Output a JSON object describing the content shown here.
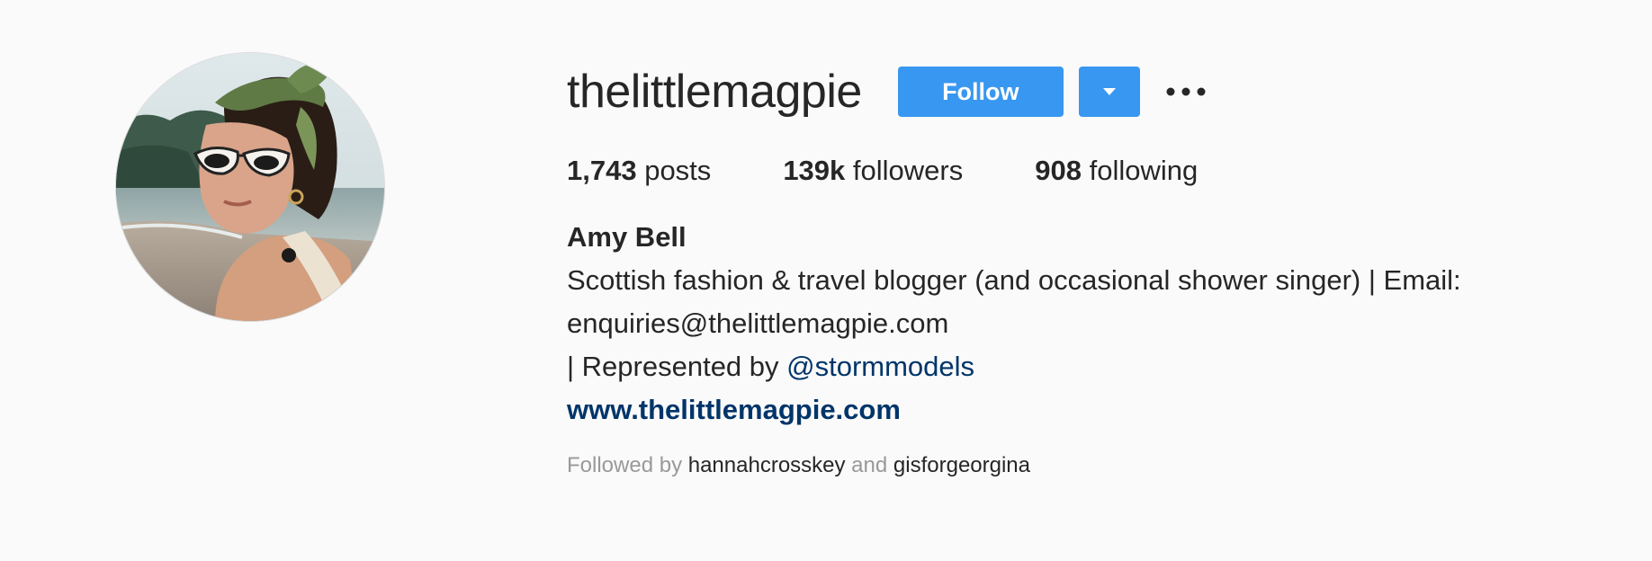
{
  "profile": {
    "username": "thelittlemagpie",
    "avatar_alt": "profile-photo"
  },
  "actions": {
    "follow_label": "Follow",
    "dropdown_icon": "caret-down-icon",
    "more_icon": "ellipsis-icon"
  },
  "stats": {
    "posts_count": "1,743",
    "posts_label": "posts",
    "followers_count": "139k",
    "followers_label": "followers",
    "following_count": "908",
    "following_label": "following"
  },
  "bio": {
    "full_name": "Amy Bell",
    "line1": "Scottish fashion & travel blogger (and occasional shower singer) | Email:",
    "line2": "enquiries@thelittlemagpie.com",
    "line3_prefix": "| Represented by ",
    "mention": "@stormmodels",
    "website": "www.thelittlemagpie.com"
  },
  "followed_by": {
    "prefix": "Followed by ",
    "user1": "hannahcrosskey",
    "conjunction": " and ",
    "user2": "gisforgeorgina"
  },
  "colors": {
    "accent": "#3897f0",
    "link": "#003569",
    "text": "#262626",
    "muted": "#999999",
    "background": "#fafafa"
  }
}
